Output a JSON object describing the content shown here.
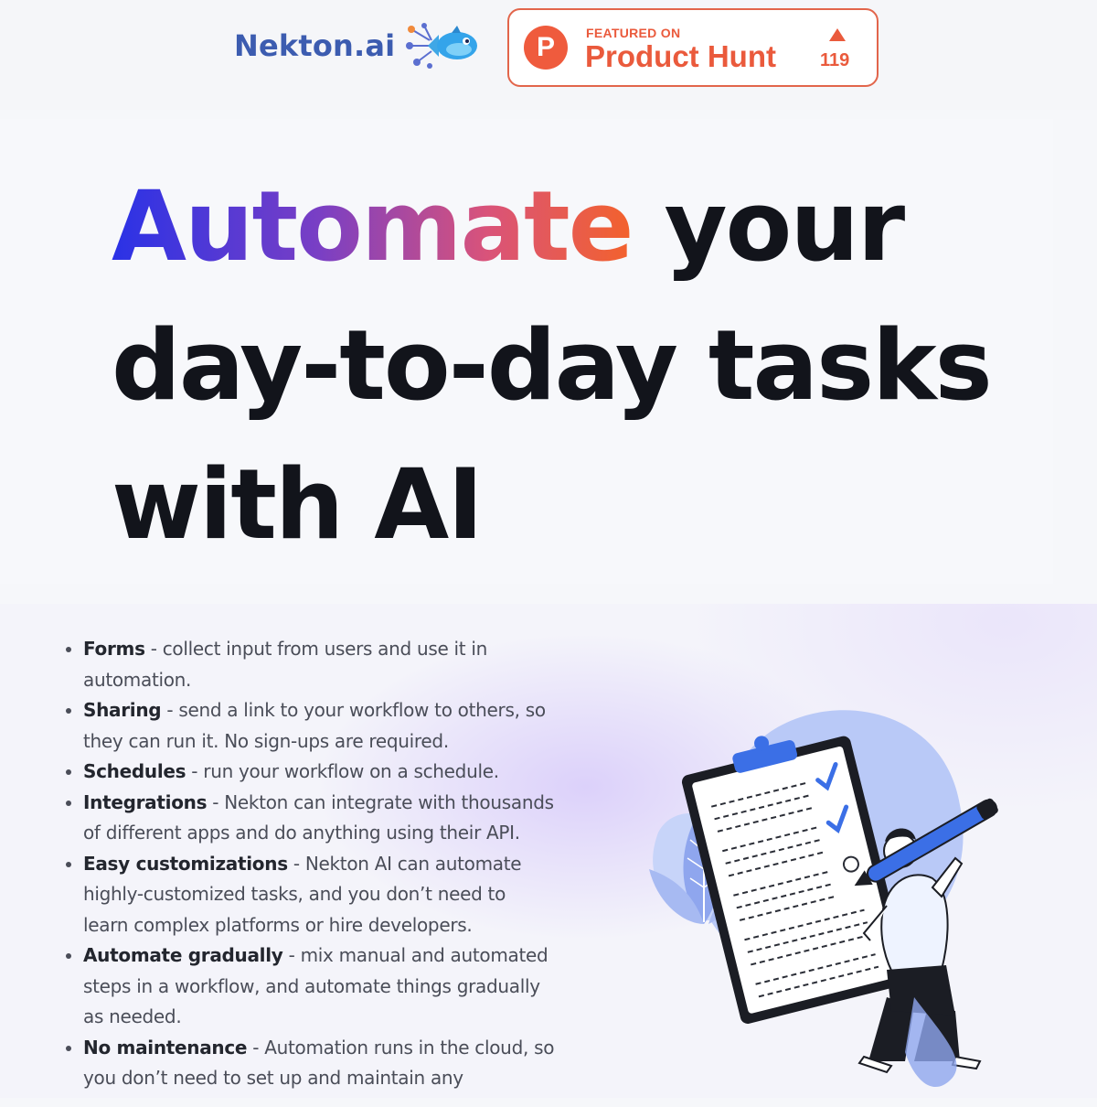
{
  "header": {
    "logo_text": "Nekton.ai",
    "badge": {
      "featured_label": "FEATURED ON",
      "name": "Product Hunt",
      "votes": "119"
    }
  },
  "hero": {
    "title_highlight": "Automate",
    "title_line1_rest": " your",
    "title_line2": "day-to-day tasks",
    "title_line3": "with AI"
  },
  "features": [
    {
      "title": "Forms",
      "desc": " - collect input from users and use it in automation."
    },
    {
      "title": "Sharing",
      "desc": " - send a link to your workflow to others, so they can run it. No sign-ups are required."
    },
    {
      "title": "Schedules",
      "desc": " - run your workflow on a schedule."
    },
    {
      "title": "Integrations",
      "desc": " - Nekton can integrate with thousands of different apps and do anything using their API."
    },
    {
      "title": "Easy customizations",
      "desc": " - Nekton AI can automate highly-customized tasks, and you don’t need to learn complex platforms or hire developers."
    },
    {
      "title": "Automate gradually",
      "desc": " - mix manual and automated steps in a workflow, and automate things gradually as needed."
    },
    {
      "title": "No maintenance",
      "desc": " - Automation runs in the cloud, so you don’t need to set up and maintain any"
    }
  ],
  "colors": {
    "brand_blue": "#3c5cb0",
    "product_hunt": "#ea5a3c",
    "gradient_start": "#2a32e6",
    "gradient_end": "#f3622c",
    "heading": "#12141b"
  },
  "icons": {
    "logo": "fish-network-icon",
    "badge": "product-hunt-p-icon",
    "vote": "upvote-triangle-icon"
  }
}
